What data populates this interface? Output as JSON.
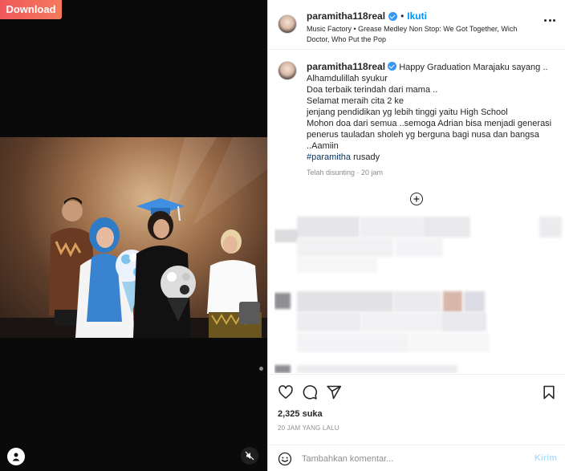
{
  "media": {
    "download_label": "Download"
  },
  "header": {
    "username": "paramitha118real",
    "separator": "•",
    "follow_label": "Ikuti",
    "music": "Music Factory • Grease Medley Non Stop: We Got Together, Wich Doctor, Who Put the Pop"
  },
  "caption": {
    "username": "paramitha118real",
    "first_line": "Happy Graduation Marajaku sayang ..",
    "lines": [
      "Alhamdulillah syukur",
      "Doa terbaik terindah dari mama ..",
      "Selamat meraih cita 2 ke",
      "jenjang pendidikan yg lebih tinggi yaitu High School",
      "Mohon doa dari semua ..semoga Adrian bisa menjadi generasi penerus tauladan sholeh yg berguna bagi nusa dan bangsa",
      "..Aamiin"
    ],
    "hashtag": "#paramitha",
    "hashtag_suffix": " rusady",
    "edited": "Telah disunting · 20 jam"
  },
  "actions": {
    "likes": "2,325 suka",
    "time_ago": "20 JAM YANG LALU",
    "comment_placeholder": "Tambahkan komentar...",
    "post_label": "Kirim"
  },
  "icons": {
    "more": "more-options-icon",
    "like": "heart-icon",
    "comment": "comment-icon",
    "share": "share-icon",
    "save": "bookmark-icon",
    "emoji": "emoji-icon",
    "load_more": "plus-circle-icon",
    "profile": "profile-icon",
    "mute": "mute-icon"
  },
  "colors": {
    "accent": "#0095f6",
    "verified": "#3897f0",
    "download_start": "#f0585b",
    "download_end": "#f47a5c"
  }
}
